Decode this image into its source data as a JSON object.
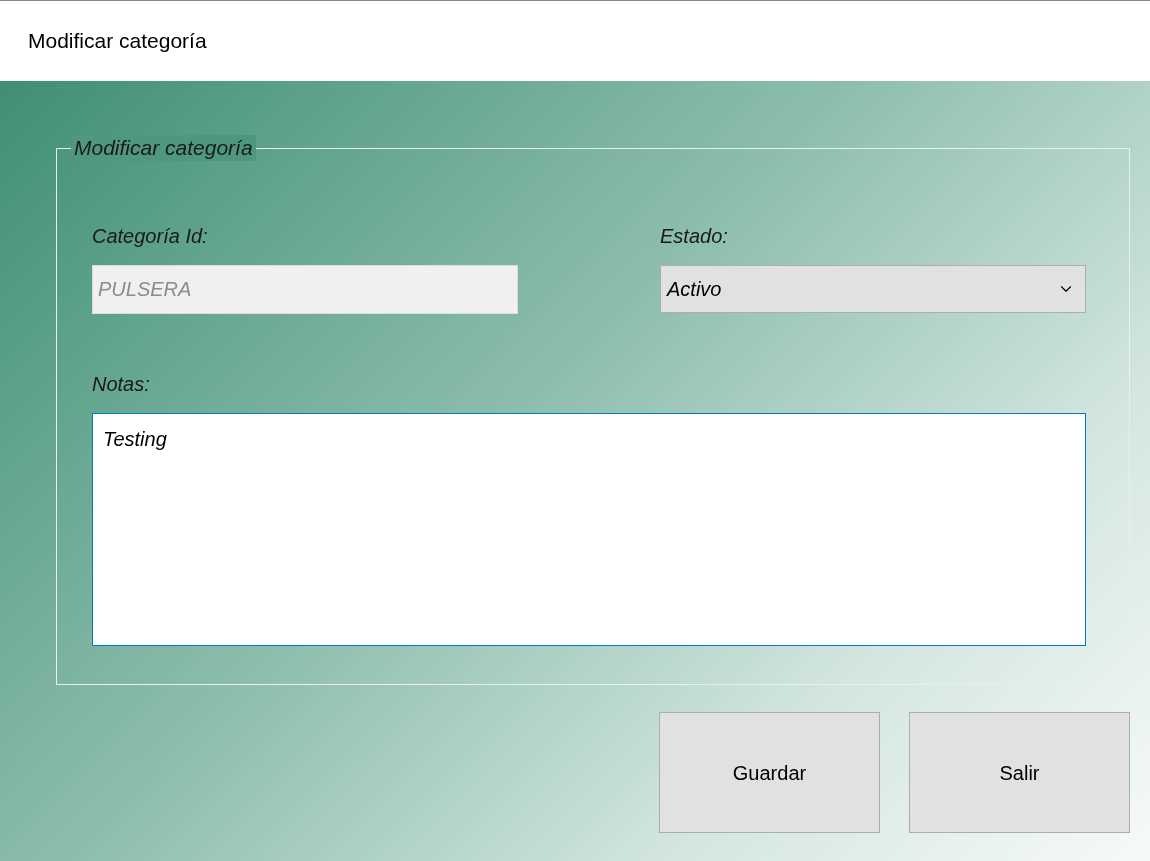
{
  "window": {
    "title": "Modificar categoría"
  },
  "group": {
    "title": "Modificar categoría"
  },
  "id_field": {
    "label": "Categoría Id:",
    "value": "PULSERA",
    "disabled": true
  },
  "estado_field": {
    "label": "Estado:",
    "value": "Activo"
  },
  "notas_field": {
    "label": "Notas:",
    "value": "Testing",
    "focused": true
  },
  "buttons": [
    "Guardar",
    "Salir"
  ]
}
